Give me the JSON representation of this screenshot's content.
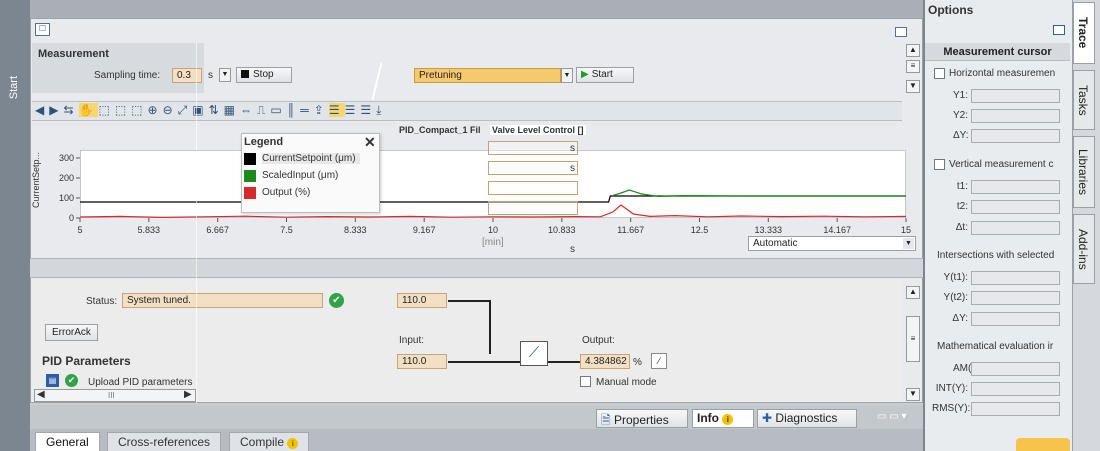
{
  "left_strip": {
    "label": "Start"
  },
  "measurement": {
    "title": "Measurement",
    "sampling_label": "Sampling time:",
    "sampling_value": "0.3",
    "sampling_unit": "s",
    "stop_label": "Stop",
    "mode_value": "Pretuning",
    "start_label": "Start"
  },
  "chart_panel": {
    "title": "PID_Compact_1 Fil",
    "title2": "Valve Level Control []",
    "ylabel": "CurrentSetp...",
    "mode_select": "Automatic",
    "unit_s": "s",
    "unit_min": "[min]"
  },
  "legend": {
    "title": "Legend",
    "close": "✕",
    "items": [
      {
        "label": "CurrentSetpoint (μm)",
        "color": "#000000"
      },
      {
        "label": "ScaledInput (μm)",
        "color": "#1a8a1a"
      },
      {
        "label": "Output (%)",
        "color": "#d42a2a"
      }
    ]
  },
  "chart_data": {
    "type": "line",
    "x_ticks": [
      "5",
      "5.833",
      "6.667",
      "7.5",
      "8.333",
      "9.167",
      "10",
      "10.833",
      "11.667",
      "12.5",
      "13.333",
      "14.167",
      "15"
    ],
    "y_ticks": [
      "0",
      "100",
      "200",
      "300"
    ],
    "xlim": [
      5,
      15
    ],
    "ylim": [
      0,
      330
    ],
    "ylabel": "CurrentSetp...",
    "xlabel": "[min]",
    "series": [
      {
        "name": "CurrentSetpoint (μm)",
        "color": "#000000",
        "x": [
          5,
          11.4,
          11.42,
          15
        ],
        "y": [
          80,
          80,
          110,
          110
        ]
      },
      {
        "name": "ScaledInput (μm)",
        "color": "#1a8a1a",
        "x": [
          11.45,
          11.55,
          11.65,
          11.8,
          12.0,
          12.3,
          13.0,
          15
        ],
        "y": [
          112,
          125,
          140,
          120,
          108,
          112,
          110,
          110
        ]
      },
      {
        "name": "Output (%)",
        "color": "#d42a2a",
        "x": [
          5,
          5.5,
          6,
          6.5,
          7,
          7.5,
          8,
          8.5,
          9,
          9.5,
          10,
          10.5,
          11,
          11.3,
          11.45,
          11.55,
          11.7,
          11.9,
          12.2,
          12.6,
          13.0,
          13.5,
          14.0,
          14.5,
          15
        ],
        "y": [
          5,
          8,
          3,
          6,
          9,
          4,
          7,
          5,
          8,
          4,
          6,
          5,
          7,
          6,
          30,
          65,
          20,
          8,
          12,
          6,
          10,
          7,
          9,
          6,
          8
        ]
      }
    ]
  },
  "status": {
    "label": "Status:",
    "value": "System tuned.",
    "setpoint_value": "110.0",
    "errorack_label": "ErrorAck",
    "input_label": "Input:",
    "input_value": "110.0",
    "output_label": "Output:",
    "output_value": "4.384862",
    "output_unit": "%",
    "manual_label": "Manual mode",
    "pid_params_title": "PID Parameters",
    "upload_label": "Upload PID parameters",
    "scroll_mid": "III"
  },
  "inspector_tabs": {
    "properties": "Properties",
    "info": "Info",
    "diagnostics": "Diagnostics"
  },
  "bottom_tabs": [
    "General",
    "Cross-references",
    "Compile"
  ],
  "options": {
    "title": "Options",
    "cursor_header": "Measurement cursor",
    "horizontal_label": "Horizontal measuremen",
    "y1": "Y1:",
    "y2": "Y2:",
    "dy": "ΔY:",
    "vertical_label": "Vertical measurement c",
    "t1": "t1:",
    "t2": "t2:",
    "dt": "Δt:",
    "intersections": "Intersections with selected",
    "yt1": "Y(t1):",
    "yt2": "Y(t2):",
    "dy2": "ΔY:",
    "math_eval": "Mathematical evaluation ir",
    "am": "AM(Y):",
    "int": "INT(Y):",
    "rms": "RMS(Y):"
  },
  "right_tabs": [
    "Trace",
    "Tasks",
    "Libraries",
    "Add-ins"
  ]
}
